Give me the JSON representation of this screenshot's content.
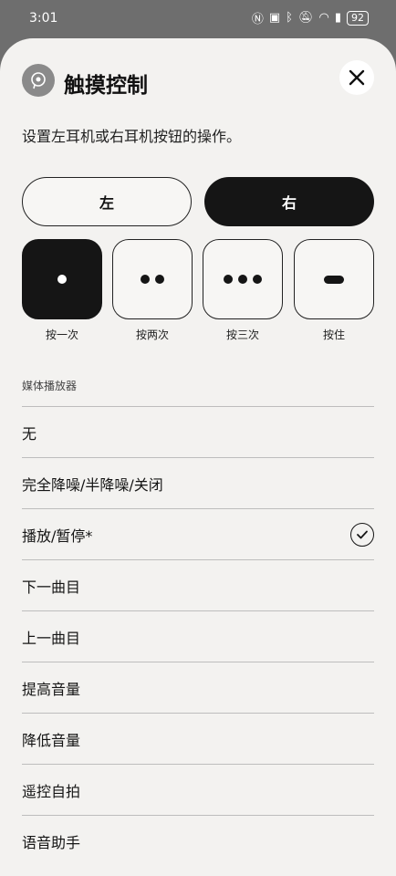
{
  "status_bar": {
    "time": "3:01",
    "battery": "92",
    "icons": [
      "nfc-icon",
      "vibrate-icon",
      "bluetooth-icon",
      "mute-icon",
      "wifi-icon",
      "signal-icon"
    ]
  },
  "header": {
    "title": "触摸控制",
    "close_icon": "close-icon",
    "app_icon": "earbud-icon"
  },
  "subtitle": "设置左耳机或右耳机按钮的操作。",
  "side_toggle": {
    "left": "左",
    "right": "右",
    "selected": "右"
  },
  "gestures": [
    {
      "label": "按一次",
      "icon": "single-dot",
      "selected": true
    },
    {
      "label": "按两次",
      "icon": "double-dot",
      "selected": false
    },
    {
      "label": "按三次",
      "icon": "triple-dot",
      "selected": false
    },
    {
      "label": "按住",
      "icon": "bar",
      "selected": false
    }
  ],
  "section_label": "媒体播放器",
  "options": [
    {
      "label": "无",
      "checked": false
    },
    {
      "label": "完全降噪/半降噪/关闭",
      "checked": false
    },
    {
      "label": "播放/暂停*",
      "checked": true
    },
    {
      "label": "下一曲目",
      "checked": false
    },
    {
      "label": "上一曲目",
      "checked": false
    },
    {
      "label": "提高音量",
      "checked": false
    },
    {
      "label": "降低音量",
      "checked": false
    },
    {
      "label": "遥控自拍",
      "checked": false
    },
    {
      "label": "语音助手",
      "checked": false
    }
  ]
}
